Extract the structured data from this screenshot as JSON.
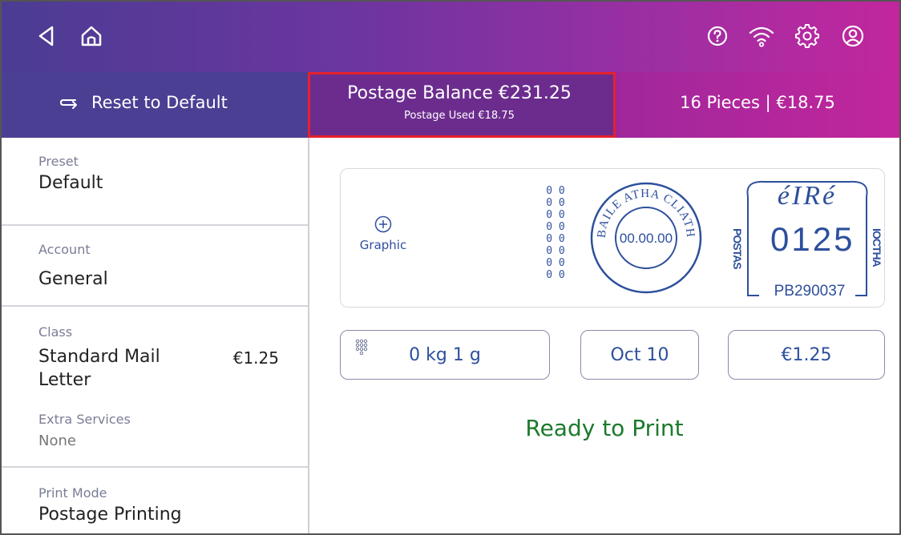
{
  "topbar": {
    "icons": [
      "back-arrow-icon",
      "home-icon",
      "help-icon",
      "wifi-icon",
      "settings-gear-icon",
      "account-icon"
    ]
  },
  "subbar": {
    "reset_label": "Reset to Default",
    "reset_icon": "return-arrow-icon",
    "balance_title": "Postage Balance €231.25",
    "balance_sub": "Postage Used €18.75",
    "pieces_label": "16 Pieces | €18.75"
  },
  "sidebar": {
    "preset": {
      "label": "Preset",
      "value": "Default"
    },
    "account": {
      "label": "Account",
      "value": "General"
    },
    "class": {
      "label": "Class",
      "value_line1": "Standard Mail",
      "value_line2": "Letter",
      "price": "€1.25"
    },
    "extra_services": {
      "label": "Extra Services",
      "value": "None"
    },
    "print_mode": {
      "label": "Print Mode",
      "value": "Postage Printing"
    }
  },
  "stamp": {
    "graphic_label": "Graphic",
    "digits": [
      "0 0",
      "0 0",
      "0 0",
      "0 0",
      "0 0",
      "0 0",
      "0 0",
      "0 0"
    ],
    "postmark_arc": "BAILE ATHA CLIATH",
    "postmark_date": "00.00.00",
    "country": "éIRé",
    "left_vertical": "POSTAS",
    "right_vertical": "IOCTHA",
    "meter_value": "0125",
    "meter_id": "PB290037"
  },
  "controls": {
    "weight": "0 kg 1 g",
    "date": "Oct 10",
    "amount": "€1.25"
  },
  "status": "Ready to Print",
  "colors": {
    "accent_blue": "#2d4f9c",
    "status_green": "#1c7a2b",
    "highlight_red": "#e4212c",
    "header_start": "#4b3c93",
    "header_end": "#c2269d"
  }
}
